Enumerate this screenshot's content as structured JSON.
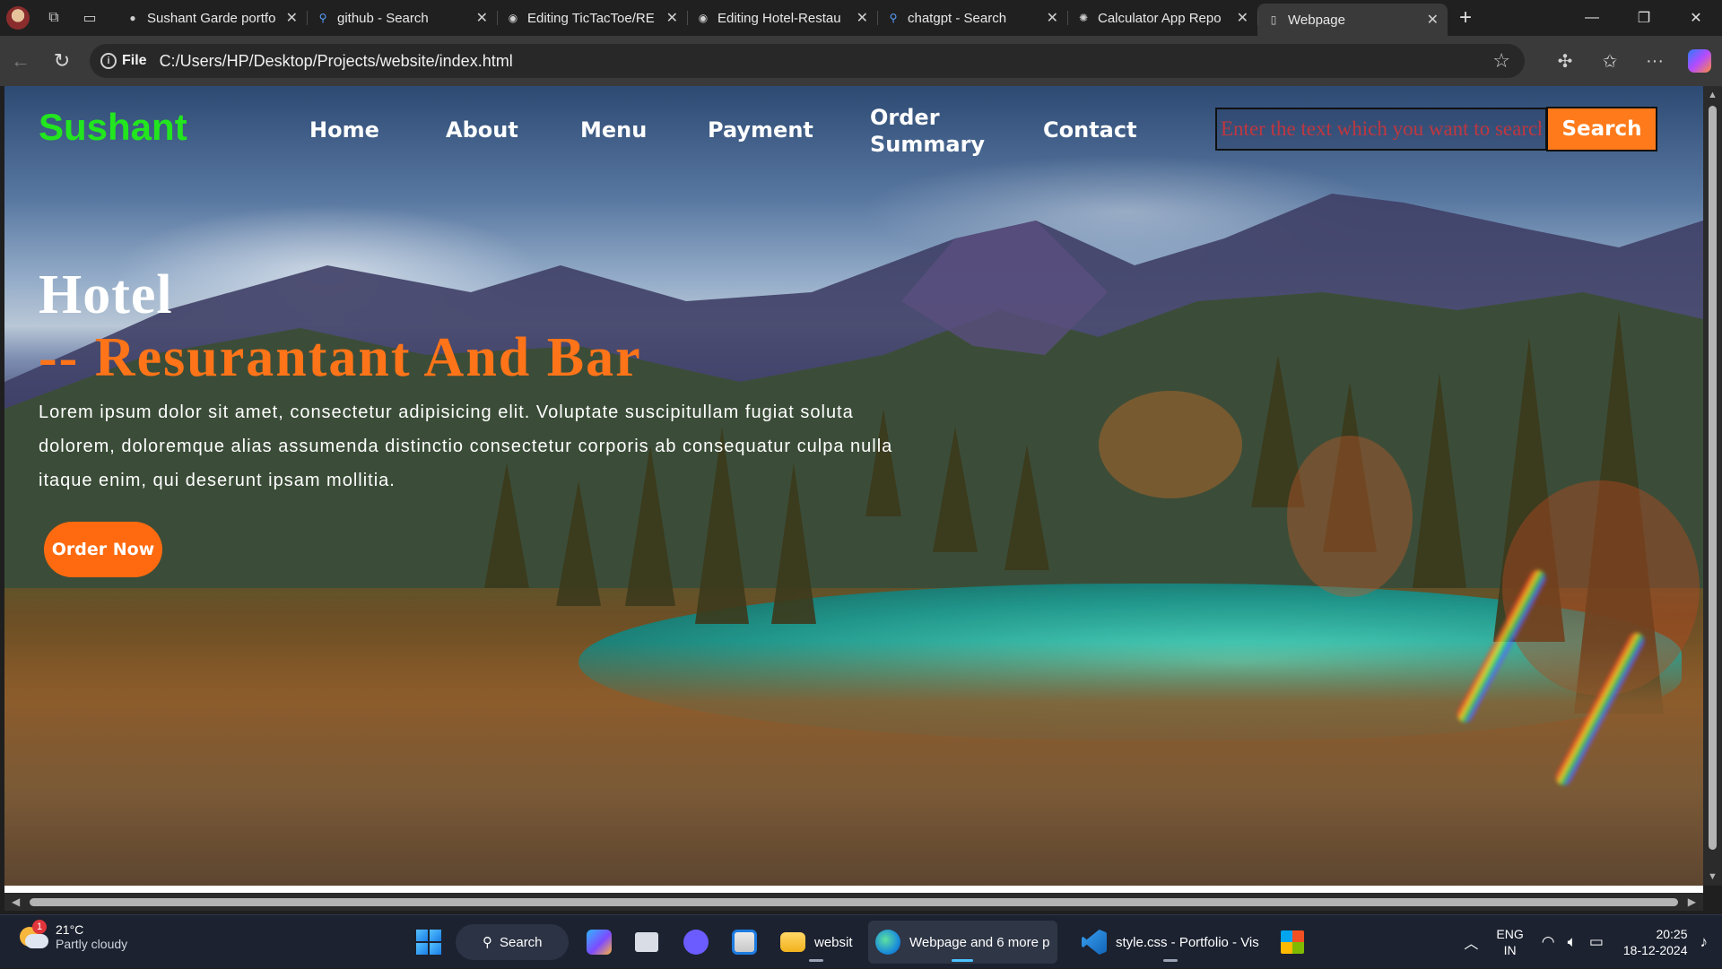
{
  "browser": {
    "tabs": [
      {
        "title": "Sushant Garde portfo",
        "icon": "github-avatar-icon",
        "active": false
      },
      {
        "title": "github - Search",
        "icon": "search-icon",
        "active": false
      },
      {
        "title": "Editing TicTacToe/RE",
        "icon": "github-icon",
        "active": false
      },
      {
        "title": "Editing Hotel-Restau",
        "icon": "github-icon",
        "active": false
      },
      {
        "title": "chatgpt - Search",
        "icon": "search-icon",
        "active": false
      },
      {
        "title": "Calculator App Repo",
        "icon": "chatgpt-icon",
        "active": false
      },
      {
        "title": "Webpage",
        "icon": "page-icon",
        "active": true
      }
    ],
    "address": {
      "scheme_label": "File",
      "url": "C:/Users/HP/Desktop/Projects/website/index.html"
    }
  },
  "site": {
    "brand": "Sushant",
    "nav": [
      {
        "label": "Home"
      },
      {
        "label": "About"
      },
      {
        "label": "Menu"
      },
      {
        "label": "Payment"
      },
      {
        "label": "Order Summary"
      },
      {
        "label": "Contact"
      }
    ],
    "search": {
      "value": "",
      "placeholder": "Enter the text which you want to search",
      "button_label": "Search"
    },
    "hero": {
      "title": "Hotel",
      "subtitle": "-- Resurantant And Bar",
      "text": "Lorem ipsum dolor sit amet, consectetur adipisicing elit. Voluptate suscipitullam fugiat soluta dolorem, doloremque alias assumenda distinctio consectetur corporis ab consequatur culpa nulla itaque enim, qui deserunt ipsam mollitia.",
      "cta_label": "Order Now"
    },
    "colors": {
      "brand": "#22e61e",
      "accent": "#ff7418",
      "placeholder": "#c0373f"
    }
  },
  "taskbar": {
    "weather": {
      "temp": "21°C",
      "condition": "Partly cloudy",
      "badge": "1"
    },
    "search_label": "Search",
    "items": [
      {
        "label": "websit"
      },
      {
        "label": "Webpage and 6 more p"
      },
      {
        "label": "style.css - Portfolio - Vis"
      }
    ],
    "tray": {
      "lang_line1": "ENG",
      "lang_line2": "IN",
      "time": "20:25",
      "date": "18-12-2024"
    }
  }
}
